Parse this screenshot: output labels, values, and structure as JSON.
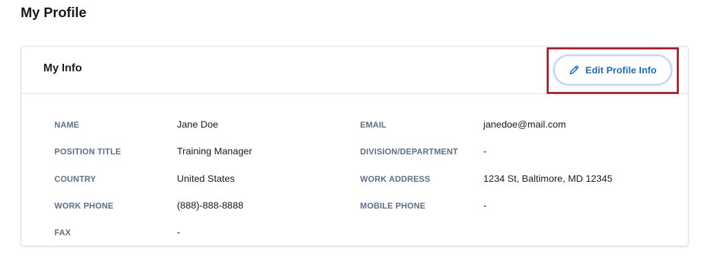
{
  "page": {
    "title": "My Profile"
  },
  "card": {
    "title": "My Info",
    "edit_button": {
      "label": "Edit Profile Info",
      "icon": "pencil-icon",
      "color": "#1a6fc9"
    },
    "highlight_color": "#b0212a"
  },
  "fields": {
    "name": {
      "label": "NAME",
      "value": "Jane Doe"
    },
    "email": {
      "label": "EMAIL",
      "value": "janedoe@mail.com"
    },
    "position_title": {
      "label": "POSITION TITLE",
      "value": "Training Manager"
    },
    "division_department": {
      "label": "DIVISION/DEPARTMENT",
      "value": "-"
    },
    "country": {
      "label": "COUNTRY",
      "value": "United States"
    },
    "work_address": {
      "label": "WORK ADDRESS",
      "value": "1234 St, Baltimore, MD 12345"
    },
    "work_phone": {
      "label": "WORK PHONE",
      "value": "(888)-888-8888"
    },
    "mobile_phone": {
      "label": "MOBILE PHONE",
      "value": "-"
    },
    "fax": {
      "label": "FAX",
      "value": "-"
    }
  }
}
